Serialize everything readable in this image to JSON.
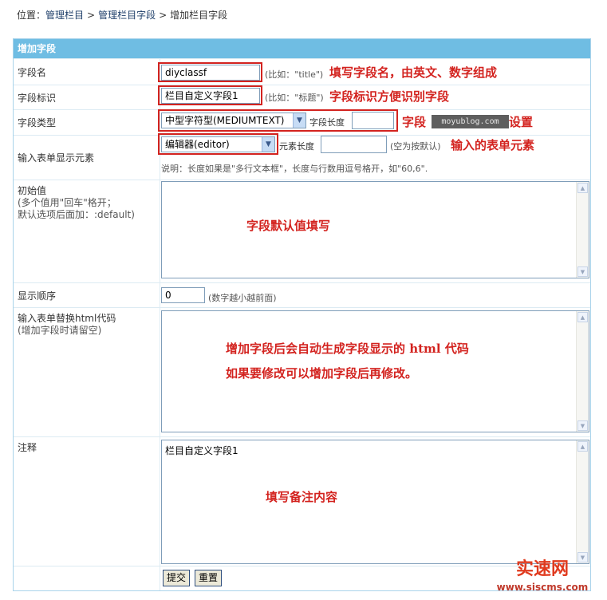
{
  "breadcrumb": {
    "prefix": "位置：",
    "items": [
      "管理栏目",
      "管理栏目字段",
      "增加栏目字段"
    ],
    "separator": ">"
  },
  "panel": {
    "title": "增加字段"
  },
  "fields": {
    "name": {
      "label": "字段名",
      "value": "diyclassf",
      "note": "(比如：\"title\")",
      "annotation": "填写字段名，由英文、数字组成"
    },
    "ident": {
      "label": "字段标识",
      "value": "栏目自定义字段1",
      "note": "(比如：\"标题\")",
      "annotation": "字段标识方便识别字段"
    },
    "type": {
      "label": "字段类型",
      "selected": "中型字符型(MEDIUMTEXT)",
      "length_label": "字段长度",
      "length_value": "",
      "annotation_start": "字段",
      "annotation_end": "设置"
    },
    "input": {
      "label": "输入表单显示元素",
      "selected": "编辑器(editor)",
      "length_label": "元素长度",
      "length_value": "",
      "note": "(空为按默认)",
      "annotation": "输入的表单元素",
      "help": "说明：长度如果是\"多行文本框\"，长度与行数用逗号格开，如\"60,6\"."
    },
    "default": {
      "label": "初始值",
      "hint": "(多个值用\"回车\"格开；\n默认选项后面加：:default)",
      "value": "",
      "annotation": "字段默认值填写"
    },
    "order": {
      "label": "显示顺序",
      "value": "0",
      "note": "(数字越小越前面)"
    },
    "html": {
      "label": "输入表单替换html代码",
      "hint": "(增加字段时请留空)",
      "value": "",
      "annotation_line1": "增加字段后会自动生成字段显示的 html 代码",
      "annotation_line2": "如果要修改可以增加字段后再修改。"
    },
    "comment": {
      "label": "注释",
      "value": "栏目自定义字段1",
      "annotation": "填写备注内容"
    }
  },
  "buttons": {
    "submit": "提交",
    "reset": "重置"
  },
  "watermark": "moyublog.com",
  "logo": {
    "main": "实速网",
    "url": "www.siscms.com"
  },
  "colors": {
    "header": "#6fbde3",
    "annotation_red": "#d3231f",
    "border": "#a9d3ea"
  }
}
